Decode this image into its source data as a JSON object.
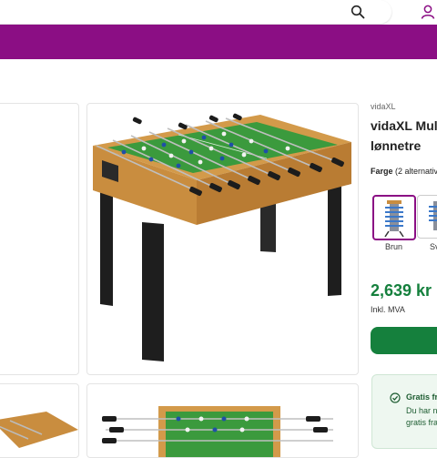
{
  "product": {
    "brand": "vidaXL",
    "title_line1": "vidaXL Mult",
    "title_line2": "lønnetre",
    "color_label": "Farge",
    "color_count": "(2 alternativ",
    "variants": [
      {
        "label": "Brun",
        "selected": true
      },
      {
        "label": "Sv",
        "selected": false
      }
    ],
    "price": "2,639 kr",
    "vat_note": "Inkl. MVA"
  },
  "delivery": {
    "title": "Gratis fra",
    "line1": "Du har n",
    "line2": "gratis fra"
  },
  "colors": {
    "nav": "#8b0e84",
    "accent_green": "#15803d",
    "wood": "#c98d3f",
    "field": "#3b9a3d"
  },
  "icons": [
    "search-icon",
    "user-icon",
    "check-circle-icon"
  ]
}
